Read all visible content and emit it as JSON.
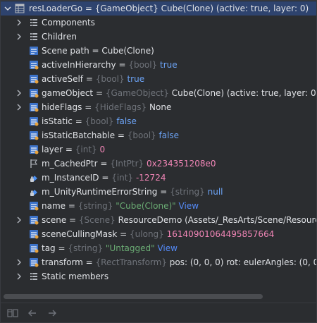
{
  "tree": {
    "root": {
      "name": "resLoaderGo",
      "eq": " = ",
      "type": "{GameObject}",
      "value": " Cube(Clone) (active: true, layer: 0)"
    },
    "components_label": "Components",
    "children_label": "Children",
    "scene_path": {
      "name": "Scene path",
      "eq": " = ",
      "value": "Cube(Clone)"
    },
    "activeInHierarchy": {
      "name": "activeInHierarchy",
      "eq": " = ",
      "type": "{bool}",
      "value": "true"
    },
    "activeSelf": {
      "name": "activeSelf",
      "eq": " = ",
      "type": "{bool}",
      "value": "true"
    },
    "gameObject": {
      "name": "gameObject",
      "eq": " = ",
      "type": "{GameObject}",
      "value": "Cube(Clone) (active: true, layer: 0)"
    },
    "hideFlags": {
      "name": "hideFlags",
      "eq": " = ",
      "type": "{HideFlags}",
      "value": "None"
    },
    "isStatic": {
      "name": "isStatic",
      "eq": " = ",
      "type": "{bool}",
      "value": "false"
    },
    "isStaticBatchable": {
      "name": "isStaticBatchable",
      "eq": " = ",
      "type": "{bool}",
      "value": "false"
    },
    "layer": {
      "name": "layer",
      "eq": " = ",
      "type": "{int}",
      "value": "0"
    },
    "m_CachedPtr": {
      "name": "m_CachedPtr",
      "eq": " = ",
      "type": "{IntPtr}",
      "value": "0x234351208e0"
    },
    "m_InstanceID": {
      "name": "m_InstanceID",
      "eq": " = ",
      "type": "{int}",
      "value": "-12724"
    },
    "m_UnityRuntimeErrorString": {
      "name": "m_UnityRuntimeErrorString",
      "eq": " = ",
      "type": "{string}",
      "value": "null"
    },
    "name": {
      "name": "name",
      "eq": " = ",
      "type": "{string}",
      "value": "\"Cube(Clone)\"",
      "link": "View"
    },
    "scene": {
      "name": "scene",
      "eq": " = ",
      "type": "{Scene}",
      "value": "ResourceDemo (Assets/_ResArts/Scene/Resource"
    },
    "sceneCullingMask": {
      "name": "sceneCullingMask",
      "eq": " = ",
      "type": "{ulong}",
      "value": "16140901064495857664"
    },
    "tag": {
      "name": "tag",
      "eq": " = ",
      "type": "{string}",
      "value": "\"Untagged\"",
      "link": "View"
    },
    "transform": {
      "name": "transform",
      "eq": " = ",
      "type": "{RectTransform}",
      "value": "pos: (0, 0, 0) rot: eulerAngles: (0, 0, 0"
    },
    "static_members_label": "Static members"
  },
  "colors": {
    "background": "#2b2d30",
    "selected": "#2e436e",
    "keyword": "#6ca3f5",
    "number": "#f286b7",
    "string": "#6aab73",
    "link": "#548af7",
    "type": "#6f737a"
  },
  "icons": {
    "root": "field-table-icon",
    "group": "group-list-icon",
    "property": "property-icon",
    "field": "field-icon",
    "flag": "flag-icon",
    "static": "static-members-icon"
  }
}
